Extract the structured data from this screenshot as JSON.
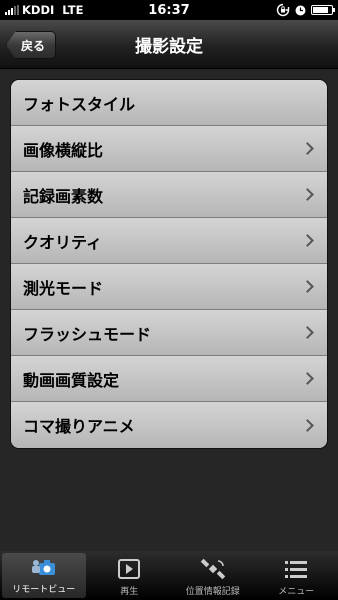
{
  "status_bar": {
    "carrier": "KDDI",
    "network": "LTE",
    "time": "16:37",
    "battery_level": 0.85
  },
  "nav": {
    "back_label": "戻る",
    "title": "撮影設定"
  },
  "settings": [
    {
      "label": "フォトスタイル",
      "has_chevron": false
    },
    {
      "label": "画像横縦比",
      "has_chevron": true
    },
    {
      "label": "記録画素数",
      "has_chevron": true
    },
    {
      "label": "クオリティ",
      "has_chevron": true
    },
    {
      "label": "測光モード",
      "has_chevron": true
    },
    {
      "label": "フラッシュモード",
      "has_chevron": true
    },
    {
      "label": "動画画質設定",
      "has_chevron": true
    },
    {
      "label": "コマ撮りアニメ",
      "has_chevron": true
    }
  ],
  "tabs": [
    {
      "label": "リモートビュー",
      "icon": "camera-icon",
      "active": true
    },
    {
      "label": "再生",
      "icon": "play-icon",
      "active": false
    },
    {
      "label": "位置情報記録",
      "icon": "satellite-icon",
      "active": false
    },
    {
      "label": "メニュー",
      "icon": "menu-icon",
      "active": false
    }
  ]
}
